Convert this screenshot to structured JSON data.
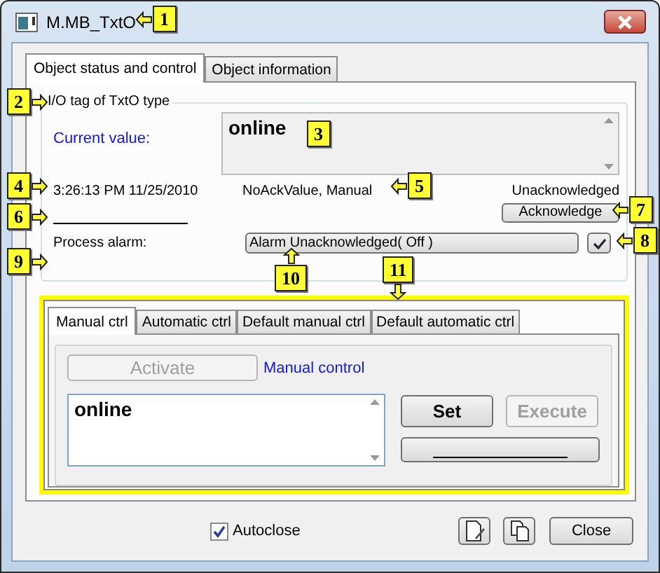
{
  "window": {
    "title": "M.MB_TxtO"
  },
  "tabs": [
    {
      "label": "Object status and control",
      "selected": true
    },
    {
      "label": "Object information",
      "selected": false
    }
  ],
  "io_group": {
    "legend": "I/O tag of TxtO type",
    "current_value_label": "Current value:",
    "current_value": "online",
    "timestamp": "3:26:13 PM 11/25/2010",
    "status": "NoAckValue, Manual",
    "ack_state": "Unacknowledged",
    "acknowledge_button": {
      "label": "Acknowledge",
      "disabled": false
    },
    "process_alarm_label": "Process alarm:",
    "process_alarm_value": "Alarm Unacknowledged( Off )"
  },
  "control_tabs": [
    {
      "label": "Manual ctrl",
      "selected": true
    },
    {
      "label": "Automatic ctrl",
      "selected": false
    },
    {
      "label": "Default manual ctrl",
      "selected": false
    },
    {
      "label": "Default automatic ctrl",
      "selected": false
    }
  ],
  "manual_panel": {
    "activate_button": {
      "label": "Activate",
      "disabled": true
    },
    "mode_label": "Manual control",
    "value": "online",
    "set_button": {
      "label": "Set",
      "disabled": false
    },
    "execute_button": {
      "label": "Execute",
      "disabled": true
    }
  },
  "autoclose": {
    "label": "Autoclose",
    "checked": true
  },
  "close_button": "Close",
  "callouts": [
    {
      "number": "1",
      "kind": "left"
    },
    {
      "number": "2",
      "kind": "right"
    },
    {
      "number": "3",
      "kind": "plain"
    },
    {
      "number": "4",
      "kind": "right"
    },
    {
      "number": "5",
      "kind": "left"
    },
    {
      "number": "6",
      "kind": "right"
    },
    {
      "number": "7",
      "kind": "left"
    },
    {
      "number": "8",
      "kind": "left"
    },
    {
      "number": "9",
      "kind": "right"
    },
    {
      "number": "10",
      "kind": "up"
    },
    {
      "number": "11",
      "kind": "down"
    }
  ]
}
